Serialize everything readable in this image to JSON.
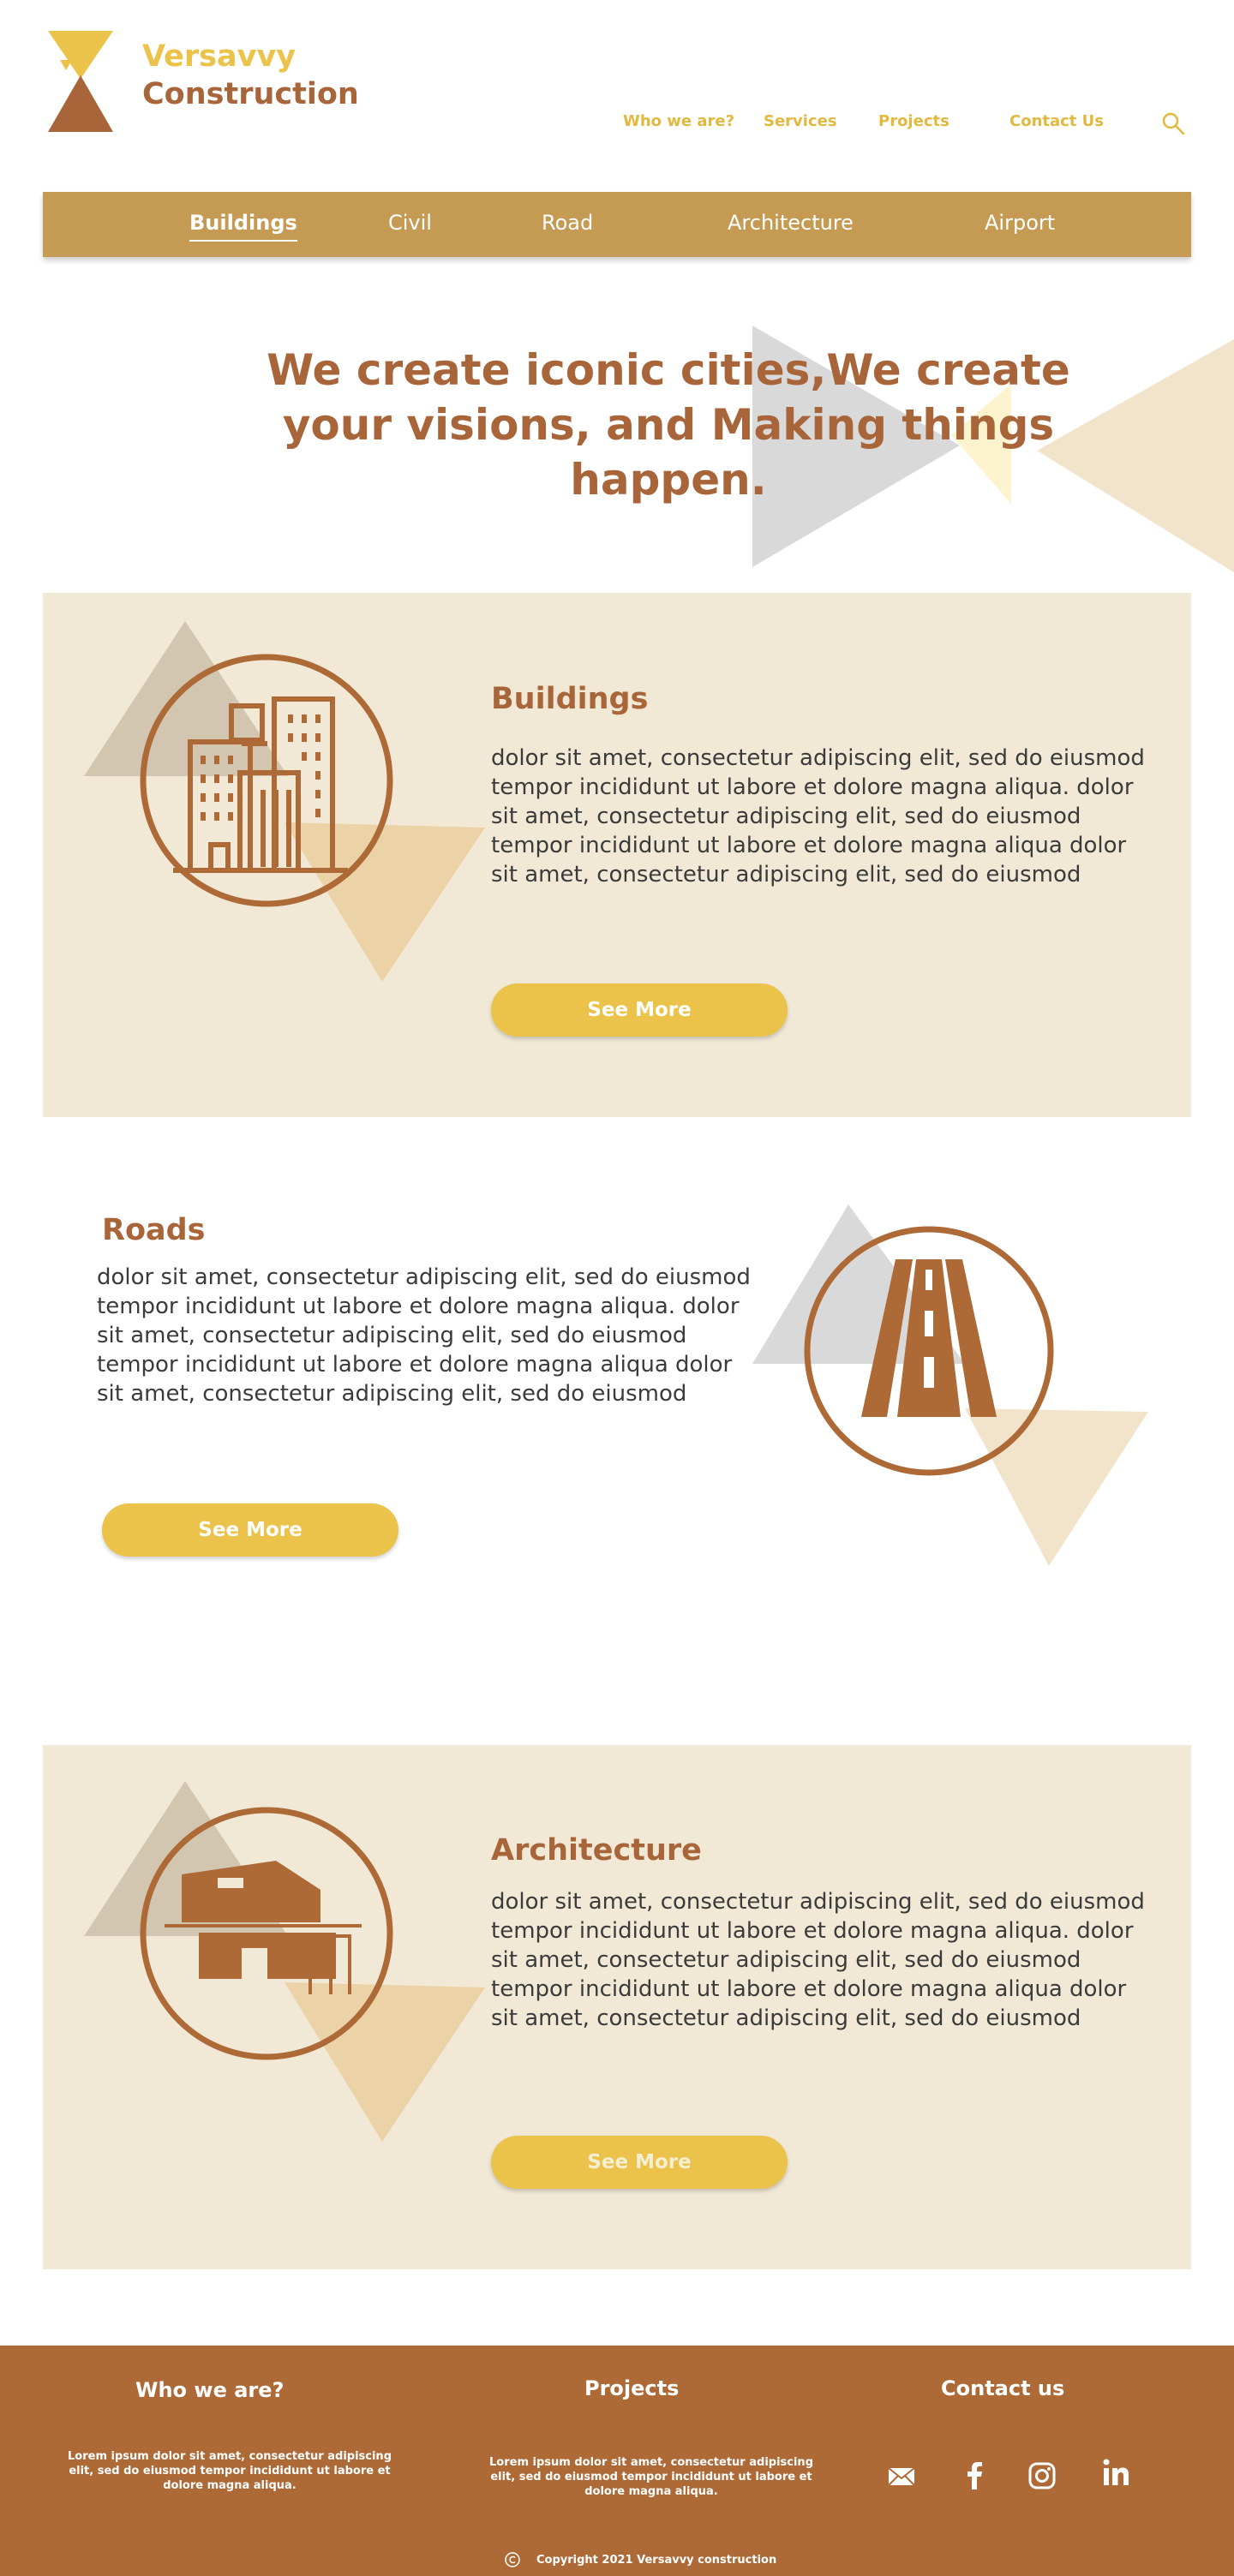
{
  "brand": {
    "line1": "Versavvy",
    "line2": "Construction",
    "logo_icon": "hourglass-triangles-logo"
  },
  "nav": {
    "items": [
      "Who we are?",
      "Services",
      "Projects",
      "Contact Us"
    ],
    "search_icon": "search-icon"
  },
  "categories": {
    "items": [
      "Buildings",
      "Civil",
      "Road",
      "Architecture",
      "Airport"
    ],
    "active": "Buildings"
  },
  "hero": {
    "title": "We create iconic cities,We create your visions, and Making things happen."
  },
  "sections": [
    {
      "title": "Buildings",
      "body": " dolor sit amet, consectetur adipiscing elit, sed do eiusmod tempor incididunt ut labore et dolore magna aliqua. dolor sit amet, consectetur adipiscing elit, sed do eiusmod tempor incididunt ut labore et dolore magna aliqua dolor sit amet, consectetur adipiscing elit, sed do eiusmod",
      "button": "See More",
      "icon": "buildings-icon"
    },
    {
      "title": "Roads",
      "body": " dolor sit amet, consectetur adipiscing elit, sed do eiusmod tempor incididunt ut labore et dolore magna aliqua. dolor sit amet, consectetur adipiscing elit, sed do eiusmod tempor incididunt ut labore et dolore magna aliqua dolor sit amet, consectetur adipiscing elit, sed do eiusmod",
      "button": "See More",
      "icon": "road-icon"
    },
    {
      "title": "Architecture",
      "body": " dolor sit amet, consectetur adipiscing elit, sed do eiusmod tempor incididunt ut labore et dolore magna aliqua. dolor sit amet, consectetur adipiscing elit, sed do eiusmod tempor incididunt ut labore et dolore magna aliqua dolor sit amet, consectetur adipiscing elit, sed do eiusmod",
      "button": "See More",
      "icon": "modern-house-icon"
    }
  ],
  "footer": {
    "who_title": "Who we are?",
    "who_text": "Lorem ipsum dolor sit amet, consectetur adipiscing elit, sed do eiusmod tempor incididunt ut labore et dolore magna aliqua.",
    "projects_title": "Projects",
    "projects_text": "Lorem ipsum dolor sit amet, consectetur adipiscing elit, sed do eiusmod tempor incididunt ut labore et dolore magna aliqua.",
    "contact_title": "Contact us",
    "social_icons": [
      "mail-icon",
      "facebook-icon",
      "instagram-icon",
      "linkedin-icon"
    ],
    "copyright_icon": "copyright-icon",
    "copyright": "Copyright 2021 Versavvy construction"
  },
  "colors": {
    "brand_gold": "#ebc24a",
    "brand_brown": "#a9653a",
    "nav_bar": "#c59a52",
    "panel": "#f1e9d6",
    "footer": "#ad6a37"
  }
}
